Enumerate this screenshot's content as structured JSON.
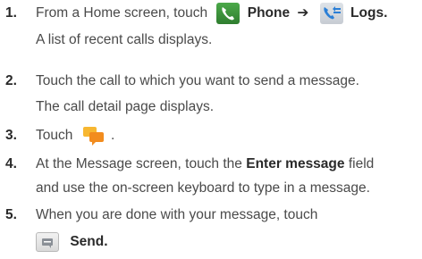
{
  "steps": [
    {
      "number": "1.",
      "lines": {
        "l1_a": "From a Home screen, touch",
        "l1_phone": "Phone",
        "l1_arrow": "➔",
        "l1_logs": "Logs",
        "l1_end": ".",
        "l2": "A list of recent calls displays."
      }
    },
    {
      "number": "2.",
      "lines": {
        "l1": "Touch the call to which you want to send a message.",
        "l2": "The call detail page displays."
      }
    },
    {
      "number": "3.",
      "lines": {
        "l1_a": "Touch",
        "l1_end": "."
      }
    },
    {
      "number": "4.",
      "lines": {
        "l1_a": "At the Message screen, touch the",
        "l1_bold": "Enter message",
        "l1_end": "field",
        "l2": "and use the on-screen keyboard to type in a message."
      }
    },
    {
      "number": "5.",
      "lines": {
        "l1": "When you are done with your message, touch",
        "l2_send": "Send",
        "l2_end": "."
      }
    }
  ],
  "icons": {
    "phone": "phone-icon",
    "logs": "call-logs-icon",
    "message": "message-icon",
    "send": "send-icon"
  },
  "colors": {
    "text": "#4a4a4a",
    "number": "#2a2a2a",
    "phone_icon": "#3b9a3b",
    "logs_icon_arrows": "#2b7fd6",
    "message_icon": "#f5a623"
  }
}
